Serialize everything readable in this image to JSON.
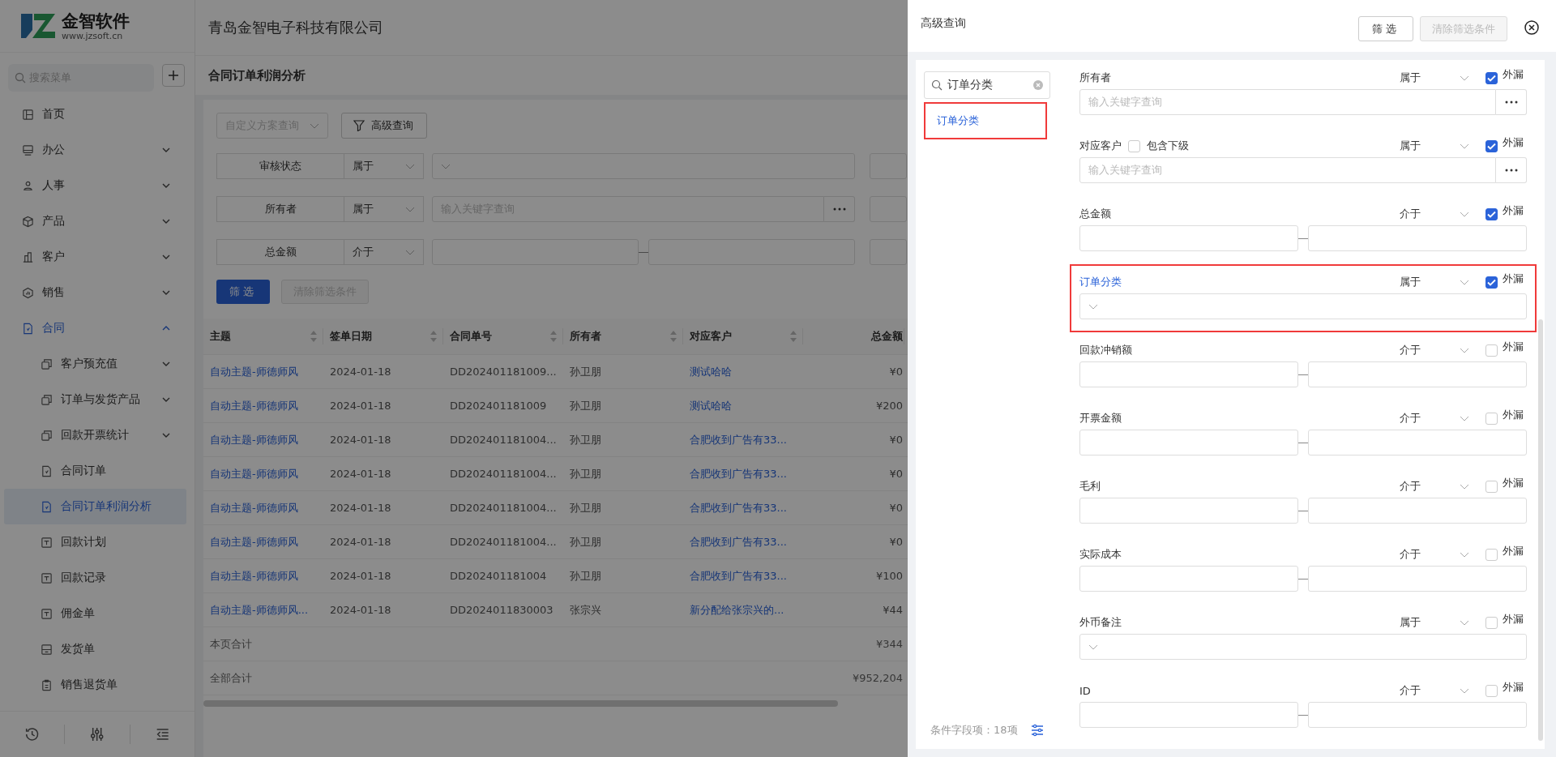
{
  "logo": {
    "name": "金智软件",
    "url": "www.jzsoft.cn"
  },
  "sidebar": {
    "search": {
      "placeholder": "搜索菜单"
    },
    "items": [
      {
        "label": "首页",
        "expandable": false,
        "expanded": false,
        "selected": false
      },
      {
        "label": "办公",
        "expandable": true,
        "expanded": false,
        "selected": false
      },
      {
        "label": "人事",
        "expandable": true,
        "expanded": false,
        "selected": false
      },
      {
        "label": "产品",
        "expandable": true,
        "expanded": false,
        "selected": false
      },
      {
        "label": "客户",
        "expandable": true,
        "expanded": false,
        "selected": false
      },
      {
        "label": "销售",
        "expandable": true,
        "expanded": false,
        "selected": false
      },
      {
        "label": "合同",
        "expandable": true,
        "expanded": true,
        "selected": false,
        "children": [
          {
            "label": "客户预充值",
            "expandable": true,
            "expanded": false,
            "selected": false
          },
          {
            "label": "订单与发货产品",
            "expandable": true,
            "expanded": false,
            "selected": false
          },
          {
            "label": "回款开票统计",
            "expandable": true,
            "expanded": false,
            "selected": false
          },
          {
            "label": "合同订单",
            "expandable": false,
            "expanded": false,
            "selected": false
          },
          {
            "label": "合同订单利润分析",
            "expandable": false,
            "expanded": false,
            "selected": true
          },
          {
            "label": "回款计划",
            "expandable": false,
            "expanded": false,
            "selected": false
          },
          {
            "label": "回款记录",
            "expandable": false,
            "expanded": false,
            "selected": false
          },
          {
            "label": "佣金单",
            "expandable": false,
            "expanded": false,
            "selected": false
          },
          {
            "label": "发货单",
            "expandable": false,
            "expanded": false,
            "selected": false
          },
          {
            "label": "销售退货单",
            "expandable": false,
            "expanded": false,
            "selected": false
          }
        ]
      }
    ]
  },
  "header": {
    "company": "青岛金智电子科技有限公司"
  },
  "page": {
    "title": "合同订单利润分析",
    "scheme_select": {
      "placeholder": "自定义方案查询"
    },
    "advanced_button": "高级查询",
    "filters": [
      {
        "label": "审核状态",
        "operator": "属于",
        "kind": "select"
      },
      {
        "label": "所有者",
        "operator": "属于",
        "kind": "keyword",
        "placeholder": "输入关键字查询"
      },
      {
        "label": "总金额",
        "operator": "介于",
        "kind": "range"
      }
    ],
    "filter_button": "筛选",
    "clear_button": {
      "label": "清除筛选条件",
      "disabled": true
    }
  },
  "table": {
    "columns": [
      {
        "label": "主题",
        "kind": "link",
        "sortable": true
      },
      {
        "label": "签单日期",
        "kind": "text",
        "sortable": true
      },
      {
        "label": "合同单号",
        "kind": "text",
        "sortable": true
      },
      {
        "label": "所有者",
        "kind": "text",
        "sortable": true
      },
      {
        "label": "对应客户",
        "kind": "link",
        "sortable": true
      },
      {
        "label": "总金额",
        "kind": "amount",
        "sortable": false
      }
    ],
    "rows": [
      [
        "自动主题-师德师风",
        "2024-01-18",
        "DD202401181009...",
        "孙卫朋",
        "测试哈哈",
        "¥0"
      ],
      [
        "自动主题-师德师风",
        "2024-01-18",
        "DD202401181009",
        "孙卫朋",
        "测试哈哈",
        "¥200"
      ],
      [
        "自动主题-师德师风",
        "2024-01-18",
        "DD202401181004...",
        "孙卫朋",
        "合肥收到广告有33...",
        "¥0"
      ],
      [
        "自动主题-师德师风",
        "2024-01-18",
        "DD202401181004...",
        "孙卫朋",
        "合肥收到广告有33...",
        "¥0"
      ],
      [
        "自动主题-师德师风",
        "2024-01-18",
        "DD202401181004...",
        "孙卫朋",
        "合肥收到广告有33...",
        "¥0"
      ],
      [
        "自动主题-师德师风",
        "2024-01-18",
        "DD202401181004...",
        "孙卫朋",
        "合肥收到广告有33...",
        "¥0"
      ],
      [
        "自动主题-师德师风",
        "2024-01-18",
        "DD202401181004",
        "孙卫朋",
        "合肥收到广告有33...",
        "¥100"
      ],
      [
        "自动主题-师德师风...",
        "2024-01-18",
        "DD2024011830003",
        "张宗兴",
        "新分配给张宗兴的...",
        "¥44"
      ]
    ],
    "totals": [
      {
        "label": "本页合计",
        "amount": "¥344"
      },
      {
        "label": "全部合计",
        "amount": "¥952,204"
      }
    ]
  },
  "drawer": {
    "title": "高级查询",
    "filter_button": "筛选",
    "clear_button": {
      "label": "清除筛选条件",
      "disabled": true
    },
    "search": {
      "value": "订单分类"
    },
    "results": [
      {
        "label": "订单分类",
        "highlighted": true
      }
    ],
    "field_count": "条件字段项：18项",
    "fields": [
      {
        "label": "所有者",
        "operator": "属于",
        "kind": "keyword",
        "placeholder": "输入关键字查询",
        "exclude_label": "外漏",
        "checked": true,
        "highlighted": false
      },
      {
        "label": "对应客户",
        "operator": "属于",
        "kind": "keyword",
        "placeholder": "输入关键字查询",
        "include_sub": {
          "label": "包含下级",
          "checked": false
        },
        "exclude_label": "外漏",
        "checked": true,
        "highlighted": false
      },
      {
        "label": "总金额",
        "operator": "介于",
        "kind": "range",
        "exclude_label": "外漏",
        "checked": true,
        "highlighted": false
      },
      {
        "label": "订单分类",
        "operator": "属于",
        "kind": "select",
        "exclude_label": "外漏",
        "checked": true,
        "highlighted": true
      },
      {
        "label": "回款冲销额",
        "operator": "介于",
        "kind": "range",
        "exclude_label": "外漏",
        "checked": false,
        "highlighted": false
      },
      {
        "label": "开票金额",
        "operator": "介于",
        "kind": "range",
        "exclude_label": "外漏",
        "checked": false,
        "highlighted": false
      },
      {
        "label": "毛利",
        "operator": "介于",
        "kind": "range",
        "exclude_label": "外漏",
        "checked": false,
        "highlighted": false
      },
      {
        "label": "实际成本",
        "operator": "介于",
        "kind": "range",
        "exclude_label": "外漏",
        "checked": false,
        "highlighted": false
      },
      {
        "label": "外币备注",
        "operator": "属于",
        "kind": "select",
        "exclude_label": "外漏",
        "checked": false,
        "highlighted": false
      },
      {
        "label": "ID",
        "operator": "介于",
        "kind": "range",
        "exclude_label": "外漏",
        "checked": false,
        "highlighted": false
      }
    ]
  }
}
